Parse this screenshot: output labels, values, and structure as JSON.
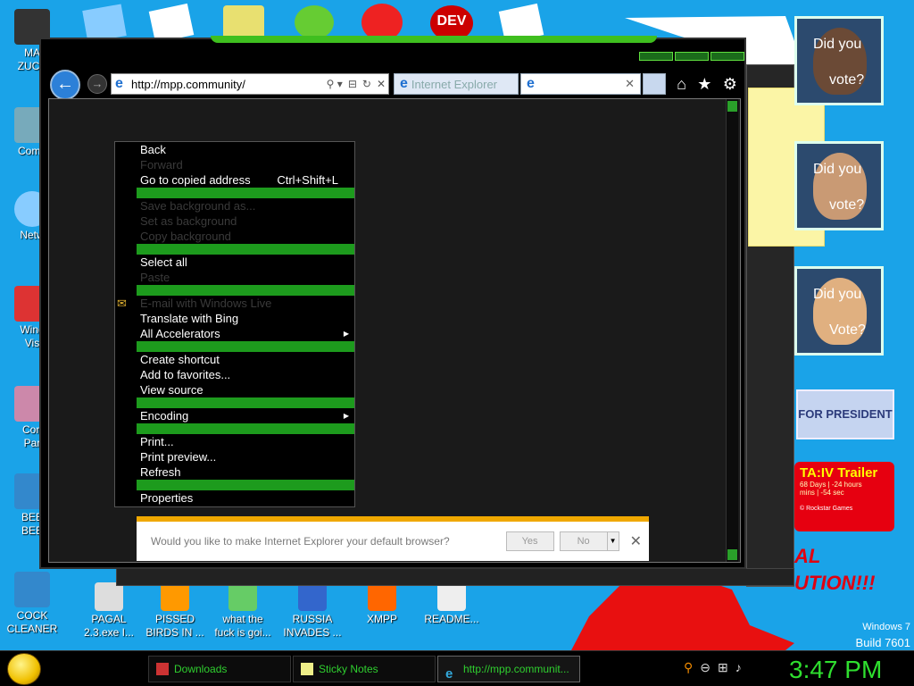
{
  "desktop": {
    "left_icons": [
      {
        "label": "MA\nZUCK"
      },
      {
        "label": "Comp"
      },
      {
        "label": "Netw"
      },
      {
        "label": "Wind\nVis"
      },
      {
        "label": "Con\nPar"
      },
      {
        "label": "BEE\nBEE"
      },
      {
        "label": "COCK\nCLEANER"
      }
    ],
    "bottom_icons": [
      {
        "label": "PAGAL\n2.3.exe I..."
      },
      {
        "label": "PISSED\nBIRDS IN ..."
      },
      {
        "label": "what the\nfuck is goi..."
      },
      {
        "label": "RUSSIA\nINVADES ..."
      },
      {
        "label": "XMPP"
      },
      {
        "label": "README..."
      }
    ],
    "top_icon_text": "DEV",
    "os_label": "Windows 7",
    "build_label": "Build 7601",
    "red_text": "AL\nUTION!!!"
  },
  "browser": {
    "address": "http://mpp.community/",
    "tabs": [
      {
        "label": "Internet Explorer"
      },
      {
        "label": ""
      }
    ],
    "context_menu": [
      {
        "type": "item",
        "label": "Back",
        "enabled": true
      },
      {
        "type": "item",
        "label": "Forward",
        "enabled": false
      },
      {
        "type": "item",
        "label": "Go to copied address",
        "shortcut": "Ctrl+Shift+L",
        "enabled": true
      },
      {
        "type": "sep"
      },
      {
        "type": "item",
        "label": "Save background as...",
        "enabled": false
      },
      {
        "type": "item",
        "label": "Set as background",
        "enabled": false
      },
      {
        "type": "item",
        "label": "Copy background",
        "enabled": false
      },
      {
        "type": "sep"
      },
      {
        "type": "item",
        "label": "Select all",
        "enabled": true
      },
      {
        "type": "item",
        "label": "Paste",
        "enabled": false
      },
      {
        "type": "sep"
      },
      {
        "type": "item",
        "label": "E-mail with Windows Live",
        "enabled": false
      },
      {
        "type": "item",
        "label": "Translate with Bing",
        "enabled": true
      },
      {
        "type": "item",
        "label": "All Accelerators",
        "enabled": true,
        "submenu": true
      },
      {
        "type": "sep"
      },
      {
        "type": "item",
        "label": "Create shortcut",
        "enabled": true
      },
      {
        "type": "item",
        "label": "Add to favorites...",
        "enabled": true
      },
      {
        "type": "item",
        "label": "View source",
        "enabled": true
      },
      {
        "type": "sep"
      },
      {
        "type": "item",
        "label": "Encoding",
        "enabled": true,
        "submenu": true
      },
      {
        "type": "sep"
      },
      {
        "type": "item",
        "label": "Print...",
        "enabled": true
      },
      {
        "type": "item",
        "label": "Print preview...",
        "enabled": true
      },
      {
        "type": "item",
        "label": "Refresh",
        "enabled": true
      },
      {
        "type": "sep"
      },
      {
        "type": "item",
        "label": "Properties",
        "enabled": true
      }
    ],
    "notification": {
      "message": "Would you like to make Internet Explorer your default browser?",
      "yes_label": "Yes",
      "no_label": "No"
    }
  },
  "gadgets": {
    "votes": [
      {
        "line1": "Did you",
        "line2": "vote?"
      },
      {
        "line1": "Did you",
        "line2": "vote?"
      },
      {
        "line1": "Did you",
        "line2": "Vote?"
      }
    ],
    "president_label": "FOR PRESIDENT",
    "gta": {
      "title": "TA:IV Trailer",
      "line1": "68 Days | -24 hours",
      "line2": "mins | -54 sec",
      "footer": "© Rockstar Games"
    }
  },
  "taskbar": {
    "buttons": [
      {
        "label": "Downloads"
      },
      {
        "label": "Sticky Notes"
      },
      {
        "label": "http://mpp.communit..."
      }
    ],
    "clock": "3:47 PM"
  },
  "colors": {
    "desktop_bg": "#1aa3e8",
    "accent_green": "#1d9b1d",
    "notify_bar": "#f0a800",
    "clock_green": "#2fdf2f"
  }
}
